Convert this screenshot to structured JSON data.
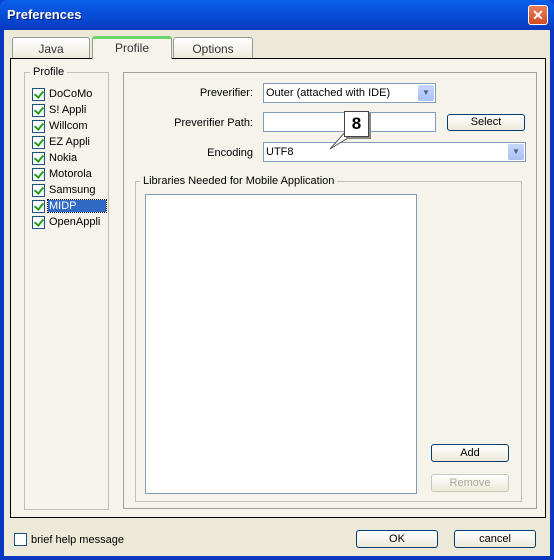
{
  "window": {
    "title": "Preferences",
    "close_icon": "close-icon"
  },
  "tabs": [
    {
      "label": "Java"
    },
    {
      "label": "Profile",
      "active": true
    },
    {
      "label": "Options"
    }
  ],
  "profile": {
    "legend": "Profile",
    "items": [
      {
        "label": "DoCoMo",
        "checked": true
      },
      {
        "label": "S! Appli",
        "checked": true
      },
      {
        "label": "Willcom",
        "checked": true
      },
      {
        "label": "EZ Appli",
        "checked": true
      },
      {
        "label": "Nokia",
        "checked": true
      },
      {
        "label": "Motorola",
        "checked": true
      },
      {
        "label": "Samsung",
        "checked": true
      },
      {
        "label": "MIDP",
        "checked": true,
        "selected": true
      },
      {
        "label": "OpenAppli",
        "checked": true
      }
    ]
  },
  "settings": {
    "preverifier_label": "Preverifier:",
    "preverifier_value": "Outer (attached with IDE)",
    "path_label": "Preverifier Path:",
    "path_value": "",
    "select_label": "Select",
    "encoding_label": "Encoding",
    "encoding_value": "UTF8",
    "callout": "8"
  },
  "libraries": {
    "legend": "Libraries Needed for Mobile Application",
    "items": [],
    "add_label": "Add",
    "remove_label": "Remove"
  },
  "footer": {
    "help_label": "brief help message",
    "help_checked": false,
    "ok_label": "OK",
    "cancel_label": "cancel"
  }
}
